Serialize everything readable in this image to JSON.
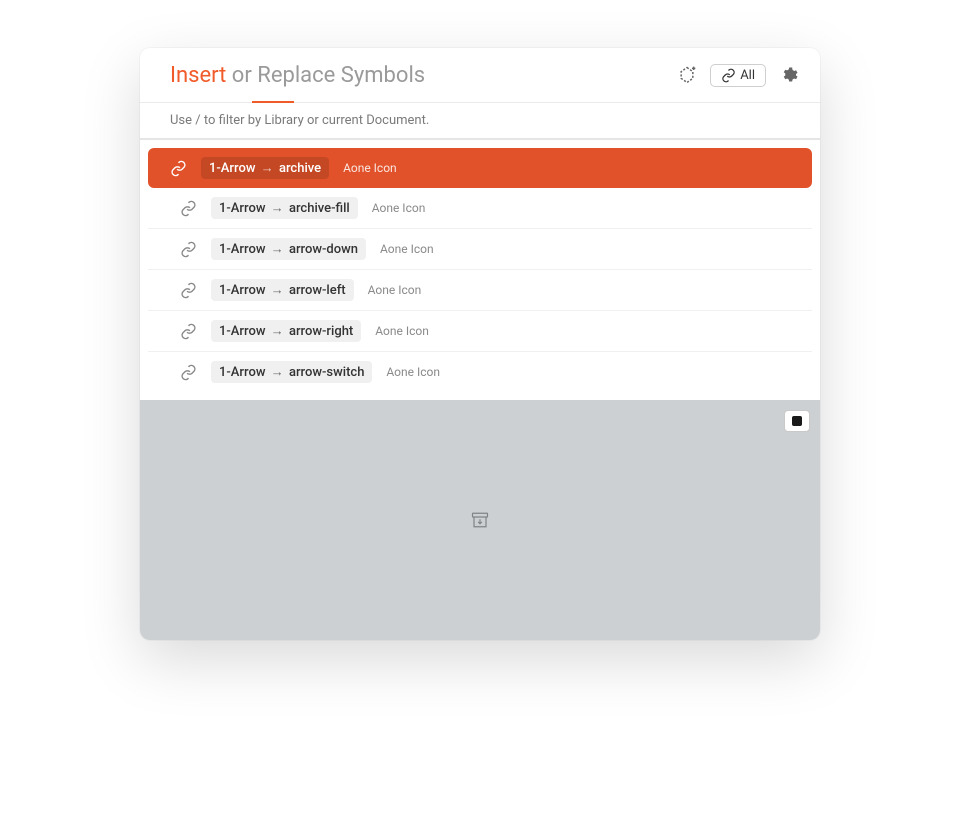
{
  "header": {
    "title_accent": "Insert",
    "title_rest": " or Replace Symbols",
    "filter_label": "All"
  },
  "hint": "Use / to filter by Library or current Document.",
  "symbols": [
    {
      "category": "1-Arrow",
      "name": "archive",
      "library": "Aone Icon",
      "selected": true
    },
    {
      "category": "1-Arrow",
      "name": "archive-fill",
      "library": "Aone Icon",
      "selected": false
    },
    {
      "category": "1-Arrow",
      "name": "arrow-down",
      "library": "Aone Icon",
      "selected": false
    },
    {
      "category": "1-Arrow",
      "name": "arrow-left",
      "library": "Aone Icon",
      "selected": false
    },
    {
      "category": "1-Arrow",
      "name": "arrow-right",
      "library": "Aone Icon",
      "selected": false
    },
    {
      "category": "1-Arrow",
      "name": "arrow-switch",
      "library": "Aone Icon",
      "selected": false
    }
  ],
  "colors": {
    "accent": "#F15A29",
    "selected_row": "#E1522A",
    "preview_bg": "#cdd0d2"
  }
}
